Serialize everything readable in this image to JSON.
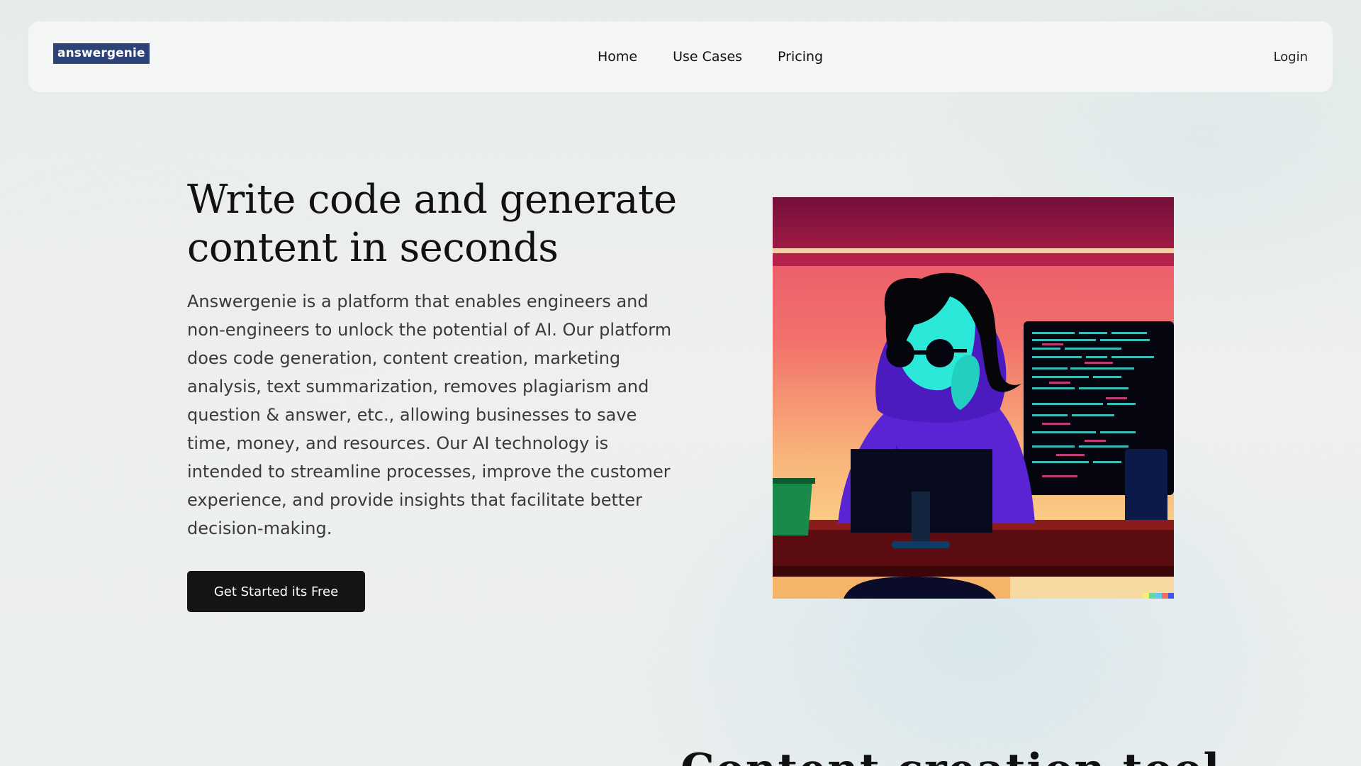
{
  "brand": {
    "logo_text": "answergenie",
    "logo_bg": "#2d4377"
  },
  "nav": {
    "links": [
      {
        "label": "Home"
      },
      {
        "label": "Use Cases"
      },
      {
        "label": "Pricing"
      }
    ],
    "login_label": "Login"
  },
  "hero": {
    "title_line1": "Write code and generate",
    "title_line2": "content in seconds",
    "description": "Answergenie is a platform that enables engineers and non-engineers to unlock the potential of AI. Our platform does code generation, content creation, marketing analysis, text summarization, removes plagiarism and question & answer, etc., allowing businesses to save time, money, and resources. Our AI technology is intended to streamline processes, improve the customer experience, and provide insights that facilitate better decision-making.",
    "cta_label": "Get Started its Free",
    "image_icon": "developer-illustration-icon"
  },
  "section2": {
    "heading_partial": "Content creation tool"
  },
  "colors": {
    "cta_bg": "#141414",
    "page_bg": "#eceeed"
  }
}
